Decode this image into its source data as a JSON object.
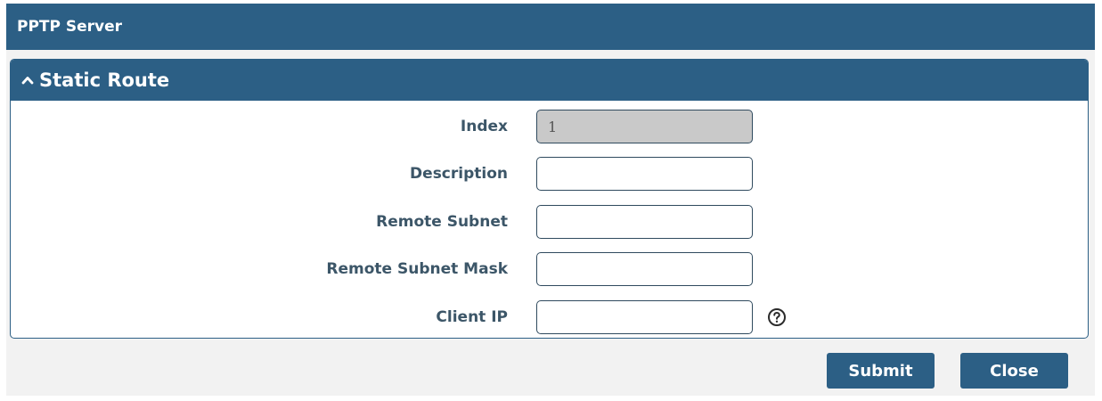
{
  "dialog": {
    "title": "PPTP Server"
  },
  "panel": {
    "title": "Static Route",
    "collapse_icon": "chevron-up-icon"
  },
  "form": {
    "index": {
      "label": "Index",
      "value": "1"
    },
    "description": {
      "label": "Description",
      "value": ""
    },
    "remote_subnet": {
      "label": "Remote Subnet",
      "value": ""
    },
    "remote_subnet_mask": {
      "label": "Remote Subnet Mask",
      "value": ""
    },
    "client_ip": {
      "label": "Client IP",
      "value": "",
      "help_icon": "question-circle-icon"
    }
  },
  "buttons": {
    "submit": "Submit",
    "close": "Close"
  },
  "colors": {
    "header": "#2c5f85",
    "label": "#3c5668",
    "background": "#f2f2f2",
    "disabled_input": "#c9c9c9"
  }
}
